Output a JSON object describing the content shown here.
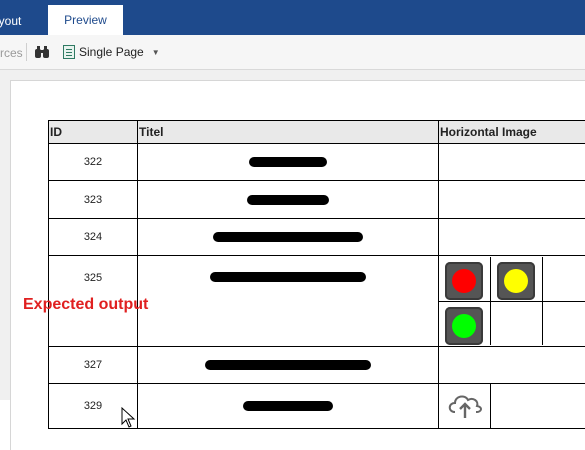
{
  "ribbon": {
    "tabs": [
      {
        "label": "ayout"
      },
      {
        "label": "Preview"
      }
    ]
  },
  "toolbar": {
    "cut_text": "rces",
    "page_mode_label": "Single Page"
  },
  "table": {
    "headers": [
      "ID",
      "Titel",
      "Horizontal Image"
    ],
    "rows": [
      {
        "id": "322"
      },
      {
        "id": "323"
      },
      {
        "id": "324"
      },
      {
        "id": "325"
      },
      {
        "id": "327"
      },
      {
        "id": "329"
      }
    ]
  },
  "traffic_lights": {
    "red": "#ff0000",
    "yellow": "#ffff00",
    "green": "#00ff00"
  },
  "annotation": {
    "text": "Expected output",
    "color": "#e02020"
  },
  "icons": [
    "binoculars-icon",
    "page-icon",
    "chevron-down-icon",
    "cloud-upload-icon",
    "mouse-cursor-icon"
  ]
}
